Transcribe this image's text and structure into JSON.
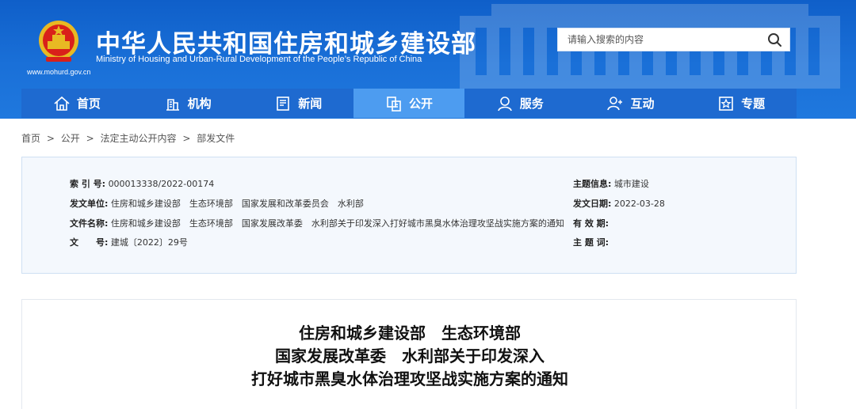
{
  "header": {
    "site_url": "www.mohurd.gov.cn",
    "title_cn": "中华人民共和国住房和城乡建设部",
    "title_en": "Ministry of Housing and Urban-Rural Development of the People’s Republic of China",
    "search_placeholder": "请输入搜索的内容",
    "search_icon": "search-icon"
  },
  "nav": {
    "items": [
      {
        "label": "首页",
        "icon": "home-icon"
      },
      {
        "label": "机构",
        "icon": "building-icon"
      },
      {
        "label": "新闻",
        "icon": "news-icon"
      },
      {
        "label": "公开",
        "icon": "document-icon",
        "active": true
      },
      {
        "label": "服务",
        "icon": "service-icon"
      },
      {
        "label": "互动",
        "icon": "interaction-icon"
      },
      {
        "label": "专题",
        "icon": "star-icon"
      }
    ]
  },
  "breadcrumb": {
    "items": [
      "首页",
      "公开",
      "法定主动公开内容",
      "部发文件"
    ],
    "separator": ">"
  },
  "info": {
    "index_label": "索 引 号:",
    "index_value": "000013338/2022-00174",
    "issuer_label": "发文单位:",
    "issuer_value": "住房和城乡建设部　生态环境部　国家发展和改革委员会　水利部",
    "docname_label": "文件名称:",
    "docname_value": "住房和城乡建设部　生态环境部　国家发展改革委　水利部关于印发深入打好城市黑臭水体治理攻坚战实施方案的通知",
    "docno_label": "文　　号:",
    "docno_value": "建城〔2022〕29号",
    "subject_label": "主题信息:",
    "subject_value": "城市建设",
    "date_label": "发文日期:",
    "date_value": "2022-03-28",
    "validity_label": "有 效 期:",
    "validity_value": "",
    "keyword_label": "主 题 词:",
    "keyword_value": ""
  },
  "article": {
    "title_line1": "住房和城乡建设部　生态环境部",
    "title_line2": "国家发展改革委　水利部关于印发深入",
    "title_line3": "打好城市黑臭水体治理攻坚战实施方案的通知"
  }
}
